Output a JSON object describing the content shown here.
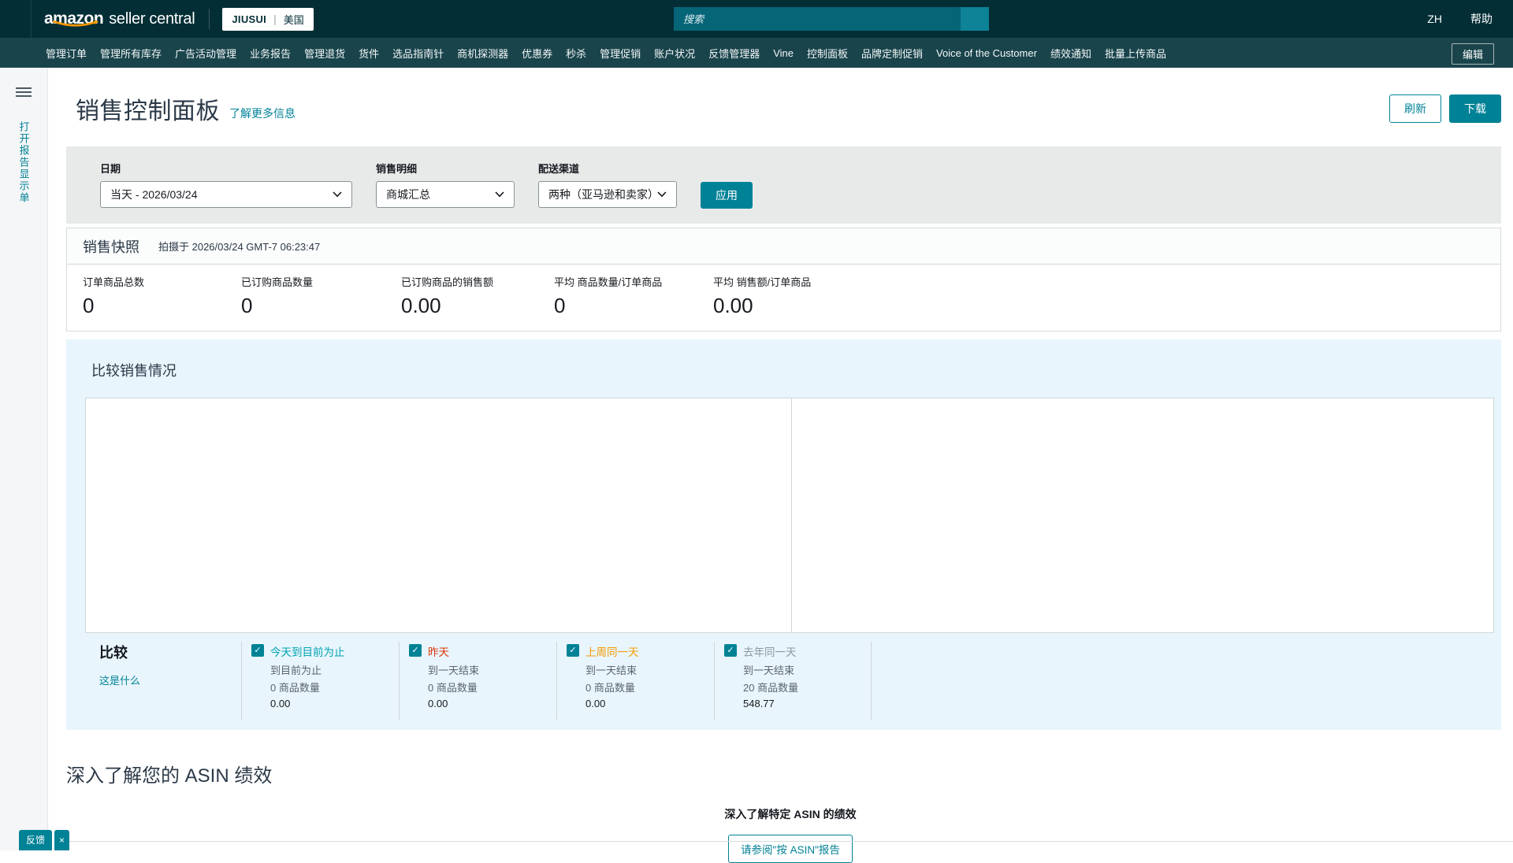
{
  "header": {
    "logo_brand": "amazon",
    "logo_suffix": "seller central",
    "account": {
      "name": "JIUSUI",
      "separator": "|",
      "marketplace": "美国"
    },
    "search": {
      "placeholder": "搜索"
    },
    "language": "ZH",
    "help": "帮助"
  },
  "nav": {
    "items": [
      "管理订单",
      "管理所有库存",
      "广告活动管理",
      "业务报告",
      "管理退货",
      "货件",
      "选品指南针",
      "商机探测器",
      "优惠券",
      "秒杀",
      "管理促销",
      "账户状况",
      "反馈管理器",
      "Vine",
      "控制面板",
      "品牌定制促销",
      "Voice of the Customer",
      "绩效通知",
      "批量上传商品"
    ],
    "edit_label": "编辑"
  },
  "sidebar": {
    "flyout_label": "打开报告显示单"
  },
  "page": {
    "title": "销售控制面板",
    "learn_more": "了解更多信息",
    "refresh_label": "刷新",
    "download_label": "下载"
  },
  "filters": {
    "date": {
      "label": "日期",
      "value": "当天 - 2026/03/24"
    },
    "sales_breakdown": {
      "label": "销售明细",
      "value": "商城汇总"
    },
    "fulfillment_channel": {
      "label": "配送渠道",
      "value": "两种（亚马逊和卖家）"
    },
    "apply_label": "应用"
  },
  "snapshot": {
    "title": "销售快照",
    "taken_at": "拍摄于 2026/03/24 GMT-7 06:23:47",
    "stats": [
      {
        "label": "订单商品总数",
        "value": "0"
      },
      {
        "label": "已订购商品数量",
        "value": "0"
      },
      {
        "label": "已订购商品的销售额",
        "value": "0.00"
      },
      {
        "label": "平均 商品数量/订单商品",
        "value": "0"
      },
      {
        "label": "平均 销售额/订单商品",
        "value": "0.00"
      }
    ]
  },
  "compare_section": {
    "title": "比较销售情况",
    "compare_label": "比较",
    "what_is_this": "这是什么",
    "series": [
      {
        "name": "今天到目前为止",
        "color": "#00a4b3",
        "period": "到目前为止",
        "units": "0 商品数量",
        "amount": "0.00",
        "checked": true
      },
      {
        "name": "昨天",
        "color": "#de350b",
        "period": "到一天结束",
        "units": "0 商品数量",
        "amount": "0.00",
        "checked": true
      },
      {
        "name": "上周同一天",
        "color": "#f59b01",
        "period": "到一天结束",
        "units": "0 商品数量",
        "amount": "0.00",
        "checked": true
      },
      {
        "name": "去年同一天",
        "color": "#8b98a0",
        "period": "到一天结束",
        "units": "20 商品数量",
        "amount": "548.77",
        "checked": true
      }
    ]
  },
  "asin_section": {
    "heading": "深入了解您的 ASIN 绩效",
    "subheading": "深入了解特定 ASIN 的绩效",
    "button_label": "请参阅\"按 ASIN\"报告"
  },
  "feedback": {
    "label": "反馈",
    "close": "×"
  },
  "icons": {
    "check": "✓",
    "close": "×"
  },
  "colors": {
    "topbar_bg": "#032e36",
    "navbar_bg": "#1a444c",
    "accent_teal": "#008296",
    "amazon_orange": "#ff9900",
    "compare_panel_bg": "#e8f5fc",
    "filter_panel_bg": "#e8eaea"
  }
}
